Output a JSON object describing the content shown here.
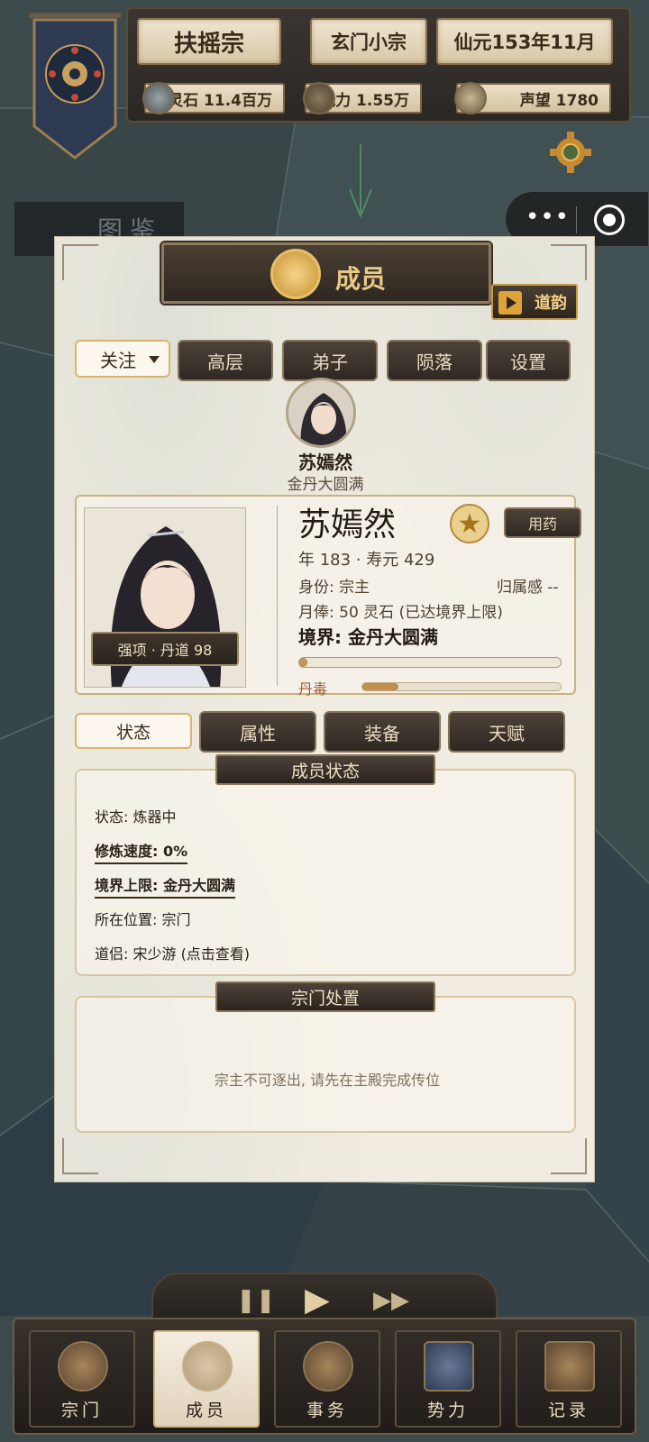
{
  "header": {
    "sect_name": "扶摇宗",
    "sect_rank": "玄门小宗",
    "date": "仙元153年11月",
    "spirit_stones": "灵石 11.4百万",
    "combat_power": "战力 1.55万",
    "reputation": "声望 1780",
    "tujian": "图鉴"
  },
  "panel": {
    "title": "成员",
    "daoyun_label": "道韵",
    "filter_selected": "关注",
    "top_tabs": [
      "高层",
      "弟子",
      "陨落",
      "设置"
    ]
  },
  "member": {
    "name": "苏嫣然",
    "realm_sub": "金丹大圆满",
    "strength_tag": "强项 · 丹道 98",
    "use_medicine": "用药",
    "age_line": "年 183 · 寿元 429",
    "identity": "身份: 宗主",
    "belonging": "归属感 --",
    "salary": "月俸: 50 灵石 (已达境界上限)",
    "realm": "境界: 金丹大圆满",
    "cultivation_progress": 0.0,
    "dan_poison_label": "丹毒",
    "dan_poison_level": 0.18
  },
  "mid_tabs": [
    "状态",
    "属性",
    "装备",
    "天赋"
  ],
  "status_section": {
    "title": "成员状态",
    "lines": [
      "状态: 炼器中",
      "修炼速度: 0%",
      "境界上限: 金丹大圆满",
      "所在位置: 宗门",
      "道侣: 宋少游 (点击查看)"
    ]
  },
  "sect_action": {
    "title": "宗门处置",
    "notice": "宗主不可逐出, 请先在主殿完成传位"
  },
  "bottom_nav": [
    "宗门",
    "成员",
    "事务",
    "势力",
    "记录"
  ],
  "icons": {
    "settings": "gear-icon",
    "capsule_more": "more-dots-icon",
    "capsule_close": "target-circle-icon",
    "star": "star-icon"
  },
  "colors": {
    "panel_bg": "#f1ece1",
    "dark_button": "#2f2822",
    "gold_accent": "#d6b46e",
    "progress": "#c19756"
  }
}
